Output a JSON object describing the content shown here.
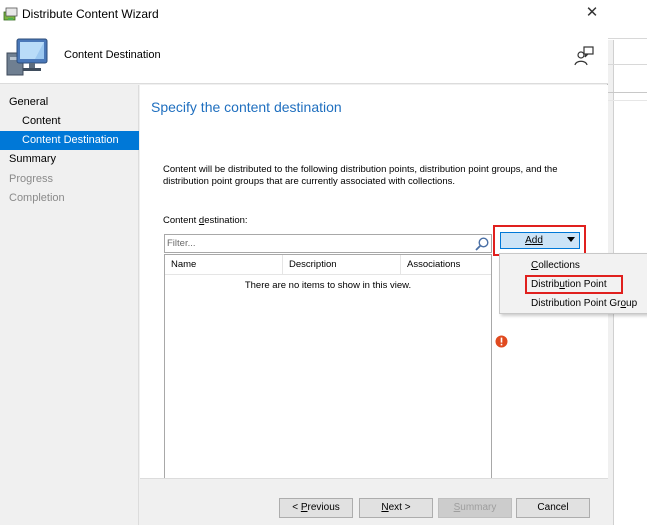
{
  "window": {
    "title": "Distribute Content Wizard"
  },
  "header": {
    "title": "Content Destination"
  },
  "nav": {
    "items": [
      {
        "label": "General",
        "level": 1,
        "state": "normal"
      },
      {
        "label": "Content",
        "level": 2,
        "state": "normal"
      },
      {
        "label": "Content Destination",
        "level": 2,
        "state": "selected"
      },
      {
        "label": "Summary",
        "level": 1,
        "state": "normal"
      },
      {
        "label": "Progress",
        "level": 1,
        "state": "disabled"
      },
      {
        "label": "Completion",
        "level": 1,
        "state": "disabled"
      }
    ]
  },
  "main": {
    "heading": "Specify the content destination",
    "description": "Content will be distributed to the following distribution points, distribution point groups, and the distribution point groups that are currently associated with collections.",
    "dest_label_pre": "Content ",
    "dest_label_u": "d",
    "dest_label_post": "estination:",
    "filter_placeholder": "Filter...",
    "columns": [
      "Name",
      "Description",
      "Associations"
    ],
    "empty_text": "There are no items to show in this view."
  },
  "add": {
    "label_u": "A",
    "label_rest": "dd",
    "menu": [
      {
        "pre": "",
        "u": "C",
        "post": "ollections",
        "highlighted": false
      },
      {
        "pre": "Distrib",
        "u": "u",
        "post": "tion Point",
        "highlighted": true
      },
      {
        "pre": "Distribution Point Gr",
        "u": "o",
        "post": "up",
        "highlighted": false
      }
    ]
  },
  "footer": {
    "previous": {
      "pre": "< ",
      "u": "P",
      "post": "revious"
    },
    "next": {
      "pre": "",
      "u": "N",
      "post": "ext >"
    },
    "summary": {
      "pre": "",
      "u": "S",
      "post": "ummary"
    },
    "cancel": "Cancel"
  },
  "colors": {
    "accent": "#0078d7",
    "heading": "#1f6fbf",
    "highlight_box": "#e0201e",
    "error": "#e04a1f"
  }
}
